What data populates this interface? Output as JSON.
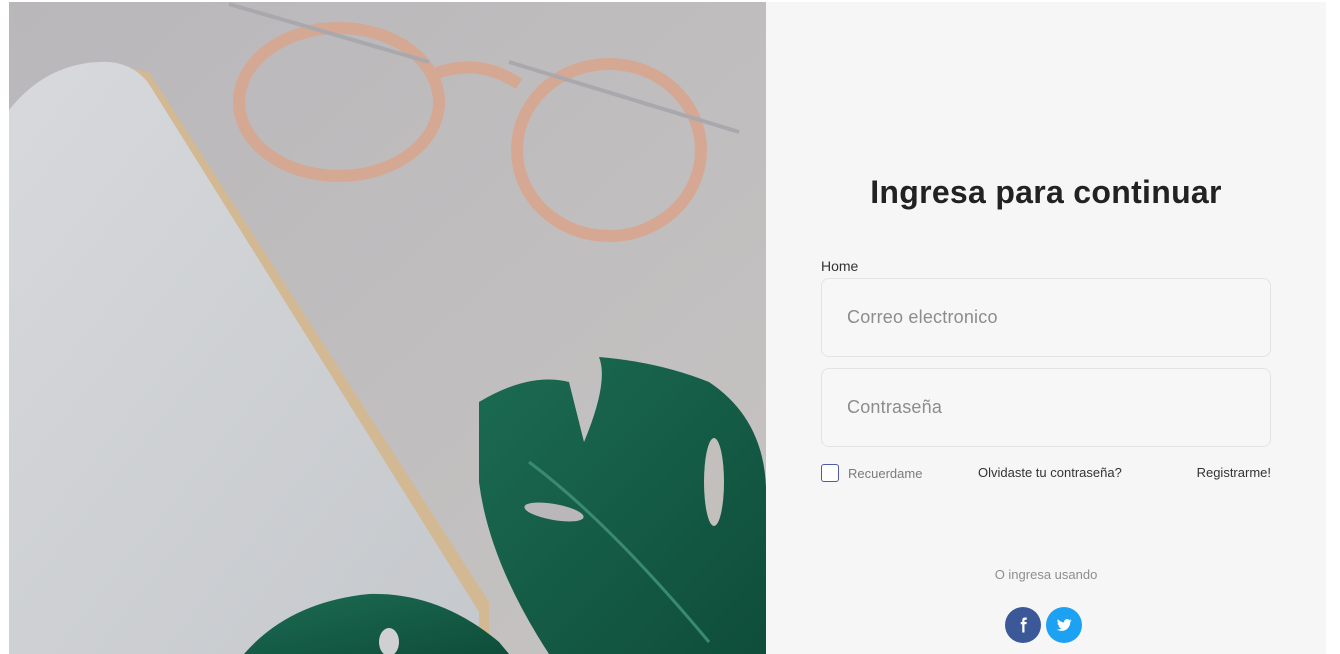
{
  "login": {
    "title": "Ingresa para continuar",
    "breadcrumb": "Home",
    "email_placeholder": "Correo electronico",
    "password_placeholder": "Contraseña",
    "remember_label": "Recuerdame",
    "forgot_link": "Olvidaste tu contraseña?",
    "register_link": "Registrarme!",
    "alt_login_text": "O ingresa usando"
  },
  "social": [
    {
      "icon": "facebook-icon",
      "color": "#3b5998"
    },
    {
      "icon": "twitter-icon",
      "color": "#1da1f2"
    }
  ],
  "colors": {
    "panel_bg": "#f6f6f6",
    "checkbox_border": "#4f5aa8"
  }
}
